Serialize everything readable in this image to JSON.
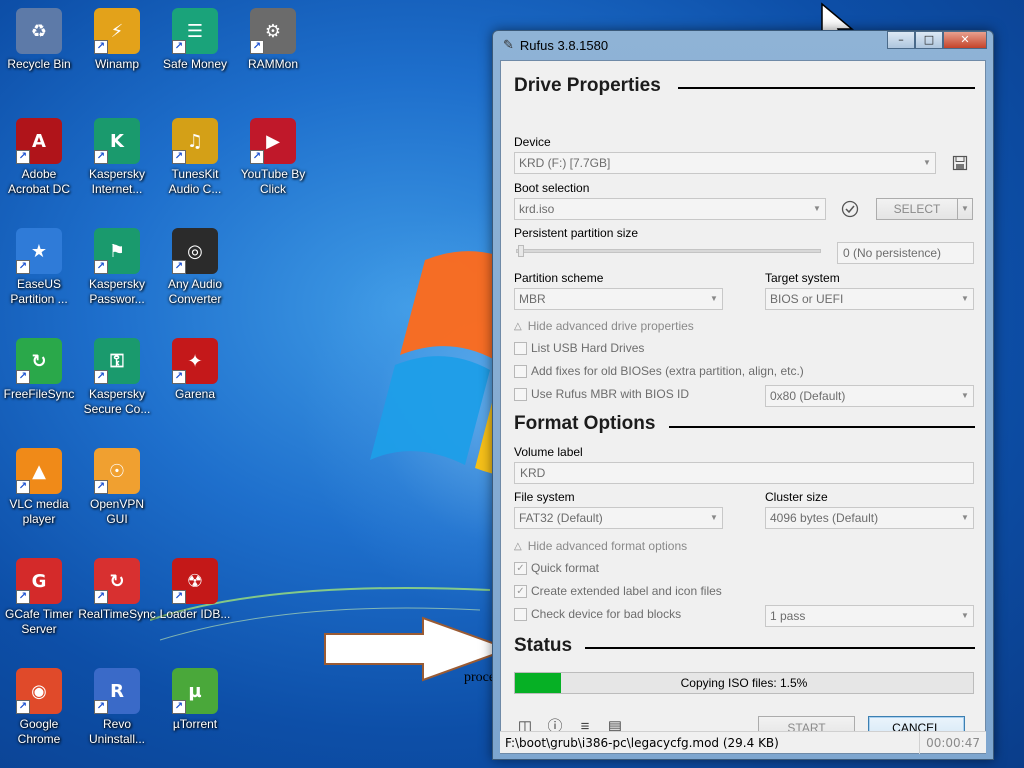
{
  "desktop": {
    "icons": [
      {
        "label": "Recycle Bin",
        "icon": "recycle-bin-icon"
      },
      {
        "label": "Winamp",
        "icon": "winamp-icon"
      },
      {
        "label": "Safe Money",
        "icon": "safe-money-icon"
      },
      {
        "label": "RAMMon",
        "icon": "rammon-icon"
      },
      {
        "label": "Adobe Acrobat DC",
        "icon": "adobe-acrobat-icon"
      },
      {
        "label": "Kaspersky Internet...",
        "icon": "kaspersky-internet-icon"
      },
      {
        "label": "TunesKit Audio C...",
        "icon": "tuneskit-icon"
      },
      {
        "label": "YouTube By Click",
        "icon": "youtube-byclick-icon"
      },
      {
        "label": "EaseUS Partition ...",
        "icon": "easeus-icon"
      },
      {
        "label": "Kaspersky Passwor...",
        "icon": "kaspersky-password-icon"
      },
      {
        "label": "Any Audio Converter",
        "icon": "any-audio-converter-icon"
      },
      {
        "label": "FreeFileSync",
        "icon": "freefilesync-icon"
      },
      {
        "label": "Kaspersky Secure Co...",
        "icon": "kaspersky-secure-icon"
      },
      {
        "label": "Garena",
        "icon": "garena-icon"
      },
      {
        "label": "VLC media player",
        "icon": "vlc-icon"
      },
      {
        "label": "OpenVPN GUI",
        "icon": "openvpn-icon"
      },
      {
        "label": "GCafe Timer Server",
        "icon": "gcafe-icon"
      },
      {
        "label": "RealTimeSync",
        "icon": "realtimesync-icon"
      },
      {
        "label": "Loader IDB...",
        "icon": "loader-icon"
      },
      {
        "label": "Google Chrome",
        "icon": "chrome-icon"
      },
      {
        "label": "Revo Uninstall...",
        "icon": "revo-icon"
      },
      {
        "label": "µTorrent",
        "icon": "utorrent-icon"
      }
    ],
    "annotation": "processing"
  },
  "window": {
    "title": "Rufus 3.8.1580",
    "controls": {
      "minimize": "–",
      "maximize": "□",
      "close": "✕"
    }
  },
  "drive": {
    "heading": "Drive Properties",
    "device_label": "Device",
    "device_value": "KRD (F:) [7.7GB]",
    "boot_label": "Boot selection",
    "boot_value": "krd.iso",
    "select_label": "SELECT",
    "persistent_label": "Persistent partition size",
    "persistent_value": "0 (No persistence)",
    "partition_label": "Partition scheme",
    "partition_value": "MBR",
    "target_label": "Target system",
    "target_value": "BIOS or UEFI",
    "hide_advanced": "Hide advanced drive properties",
    "list_usb": "List USB Hard Drives",
    "add_fixes": "Add fixes for old BIOSes (extra partition, align, etc.)",
    "use_rufus_mbr": "Use Rufus MBR with BIOS ID",
    "bios_id_value": "0x80 (Default)"
  },
  "format": {
    "heading": "Format Options",
    "volume_label": "Volume label",
    "volume_value": "KRD",
    "fs_label": "File system",
    "fs_value": "FAT32 (Default)",
    "cluster_label": "Cluster size",
    "cluster_value": "4096 bytes (Default)",
    "hide_advanced": "Hide advanced format options",
    "quick_format": "Quick format",
    "extended_label": "Create extended label and icon files",
    "check_device": "Check device for bad blocks",
    "passes_value": "1 pass"
  },
  "status": {
    "heading": "Status",
    "progress_text": "Copying ISO files: 1.5%",
    "progress_fraction": 0.1,
    "start_label": "START",
    "cancel_label": "CANCEL",
    "path": "F:\\boot\\grub\\i386-pc\\legacycfg.mod (29.4 KB)",
    "elapsed": "00:00:47"
  }
}
